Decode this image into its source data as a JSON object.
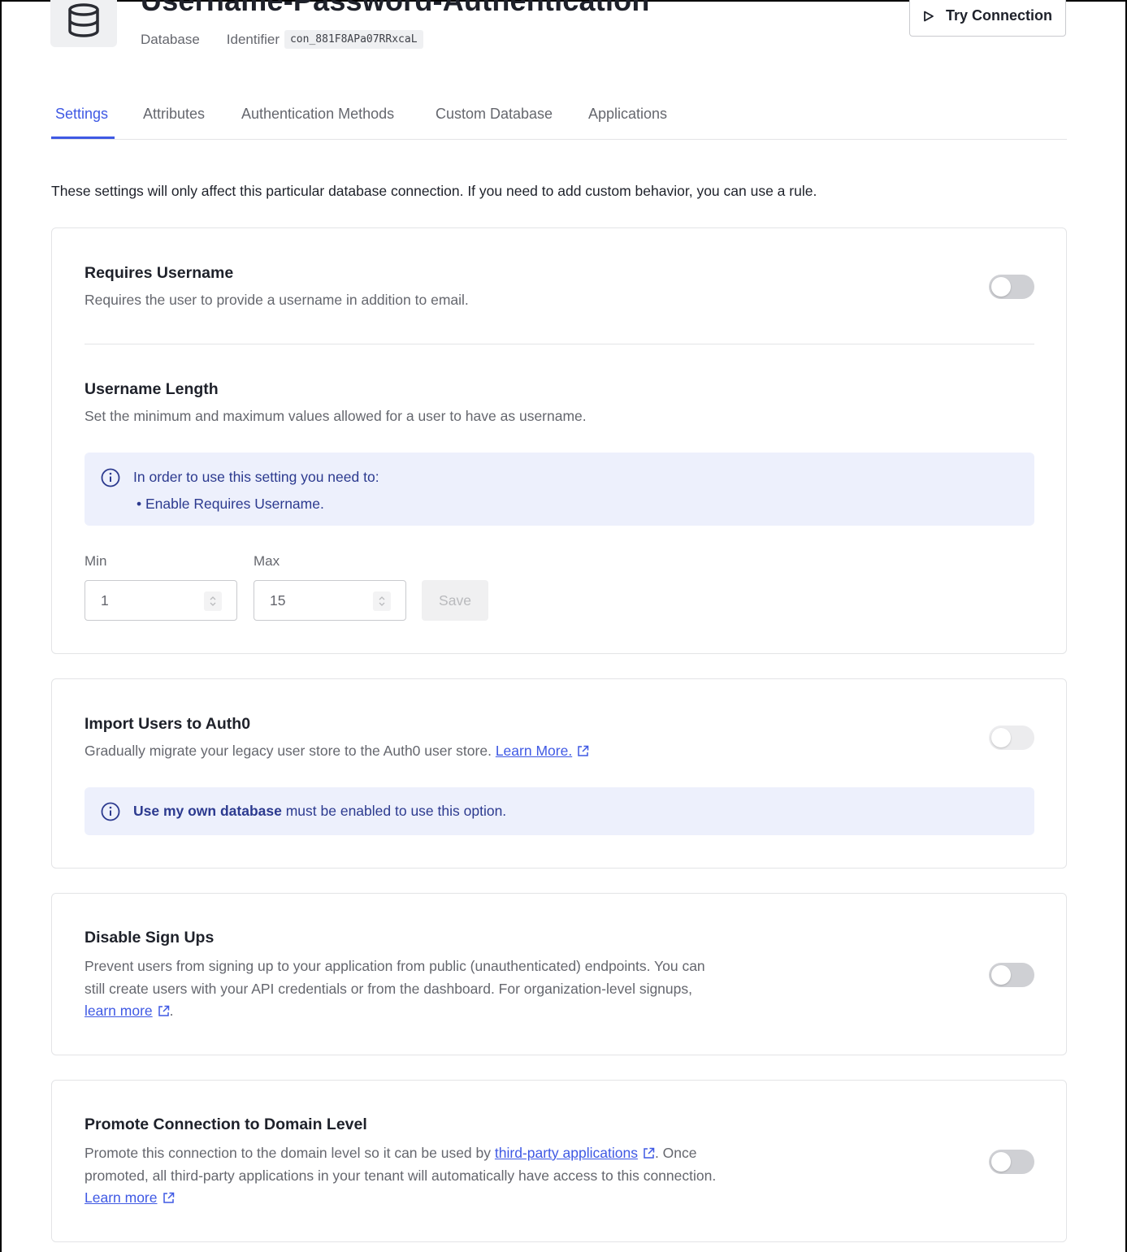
{
  "header": {
    "title": "Username-Password-Authentication",
    "type": "Database",
    "identifier_label": "Identifier",
    "identifier_value": "con_881F8APa07RRxcaL",
    "try_connection_label": "Try Connection"
  },
  "tabs": [
    {
      "label": "Settings",
      "active": true
    },
    {
      "label": "Attributes"
    },
    {
      "label": "Authentication Methods"
    },
    {
      "label": "Custom Database"
    },
    {
      "label": "Applications"
    }
  ],
  "intro": "These settings will only affect this particular database connection. If you need to add custom behavior, you can use a rule.",
  "requires_username": {
    "title": "Requires Username",
    "description": "Requires the user to provide a username in addition to email.",
    "enabled": false
  },
  "username_length": {
    "title": "Username Length",
    "description": "Set the minimum and maximum values allowed for a user to have as username.",
    "info_heading": "In order to use this setting you need to:",
    "info_item": "Enable Requires Username.",
    "min_label": "Min",
    "min_value": "1",
    "max_label": "Max",
    "max_value": "15",
    "save_label": "Save"
  },
  "import_users": {
    "title": "Import Users to Auth0",
    "description": "Gradually migrate your legacy user store to the Auth0 user store.",
    "link": "Learn More.",
    "info_bold": "Use my own database",
    "info_rest": "must be enabled to use this option.",
    "enabled": false
  },
  "disable_signups": {
    "title": "Disable Sign Ups",
    "description_line1": "Prevent users from signing up to your application from public (unauthenticated) endpoints. You can",
    "description_line2": "still create users with your API credentials or from the dashboard. For organization-level signups,",
    "link": "learn more",
    "trailing": ".",
    "enabled": false
  },
  "promote_connection": {
    "title": "Promote Connection to Domain Level",
    "description_before": "Promote this connection to the domain level so it can be used by",
    "link_inline": "third-party applications",
    "description_after": ". Once",
    "description_line2": "promoted, all third-party applications in your tenant will automatically have access to this connection.",
    "link": "Learn more",
    "enabled": false
  },
  "colors": {
    "accent": "#3f59e4",
    "info_bg": "#edf0fc",
    "info_text": "#2c3a8f",
    "toggle_off": "#cfd0d4"
  },
  "icons": {
    "database": "database-icon",
    "play": "play-icon",
    "info": "info-icon",
    "external": "external-link-icon",
    "stepper": "chevron-updown-icon"
  }
}
